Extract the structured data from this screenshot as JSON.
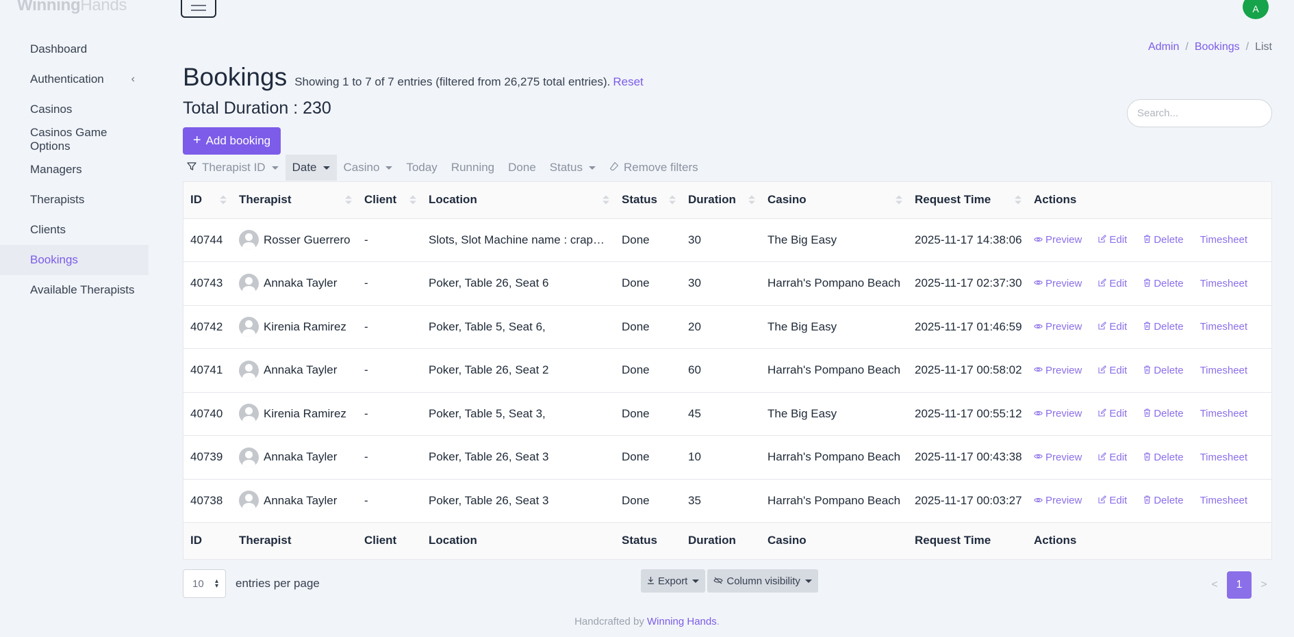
{
  "brand": {
    "strong": "Winning",
    "light": "Hands"
  },
  "user_avatar": "A",
  "sidebar": {
    "items": [
      {
        "label": "Dashboard"
      },
      {
        "label": "Authentication",
        "chevron": "‹"
      },
      {
        "label": "Casinos"
      },
      {
        "label": "Casinos Game Options"
      },
      {
        "label": "Managers"
      },
      {
        "label": "Therapists"
      },
      {
        "label": "Clients"
      },
      {
        "label": "Bookings",
        "active": true
      },
      {
        "label": "Available Therapists"
      }
    ]
  },
  "breadcrumb": {
    "admin": "Admin",
    "sep": "/",
    "bookings": "Bookings",
    "current": "List"
  },
  "header": {
    "title": "Bookings",
    "showing": "Showing 1 to 7 of 7 entries (filtered from 26,275 total entries).",
    "reset": "Reset",
    "total_duration": "Total Duration : 230",
    "search_placeholder": "Search...",
    "add_button": "Add booking"
  },
  "filters": {
    "therapist_id": "Therapist ID",
    "date": "Date",
    "casino": "Casino",
    "today": "Today",
    "running": "Running",
    "done": "Done",
    "status": "Status",
    "remove": "Remove filters"
  },
  "table": {
    "columns": {
      "id": "ID",
      "therapist": "Therapist",
      "client": "Client",
      "location": "Location",
      "status": "Status",
      "duration": "Duration",
      "casino": "Casino",
      "request_time": "Request Time",
      "actions": "Actions"
    },
    "action_labels": {
      "preview": "Preview",
      "edit": "Edit",
      "delete": "Delete",
      "timesheet": "Timesheet"
    },
    "rows": [
      {
        "id": "40744",
        "therapist": "Rosser Guerrero",
        "client": "-",
        "location": "Slots, Slot Machine name : craps…",
        "status": "Done",
        "duration": "30",
        "casino": "The Big Easy",
        "request_time": "2025-11-17 14:38:06"
      },
      {
        "id": "40743",
        "therapist": "Annaka Tayler",
        "client": "-",
        "location": "Poker, Table 26, Seat 6",
        "status": "Done",
        "duration": "30",
        "casino": "Harrah's Pompano Beach",
        "request_time": "2025-11-17 02:37:30"
      },
      {
        "id": "40742",
        "therapist": "Kirenia Ramirez",
        "client": "-",
        "location": "Poker, Table 5, Seat 6,",
        "status": "Done",
        "duration": "20",
        "casino": "The Big Easy",
        "request_time": "2025-11-17 01:46:59"
      },
      {
        "id": "40741",
        "therapist": "Annaka Tayler",
        "client": "-",
        "location": "Poker, Table 26, Seat 2",
        "status": "Done",
        "duration": "60",
        "casino": "Harrah's Pompano Beach",
        "request_time": "2025-11-17 00:58:02"
      },
      {
        "id": "40740",
        "therapist": "Kirenia Ramirez",
        "client": "-",
        "location": "Poker, Table 5, Seat 3,",
        "status": "Done",
        "duration": "45",
        "casino": "The Big Easy",
        "request_time": "2025-11-17 00:55:12"
      },
      {
        "id": "40739",
        "therapist": "Annaka Tayler",
        "client": "-",
        "location": "Poker, Table 26, Seat 3",
        "status": "Done",
        "duration": "10",
        "casino": "Harrah's Pompano Beach",
        "request_time": "2025-11-17 00:43:38"
      },
      {
        "id": "40738",
        "therapist": "Annaka Tayler",
        "client": "-",
        "location": "Poker, Table 26, Seat 3",
        "status": "Done",
        "duration": "35",
        "casino": "Harrah's Pompano Beach",
        "request_time": "2025-11-17 00:03:27"
      }
    ]
  },
  "bottom": {
    "per_page_value": "10",
    "per_page_label": "entries per page",
    "export": "Export",
    "column_visibility": "Column visibility",
    "prev": "<",
    "page": "1",
    "next": ">"
  },
  "footer": {
    "text": "Handcrafted by",
    "brand": "Winning Hands",
    "dot": "."
  },
  "colors": {
    "accent": "#7c5ce9",
    "avatar": "#16a34a",
    "background": "#f1f4f8"
  }
}
